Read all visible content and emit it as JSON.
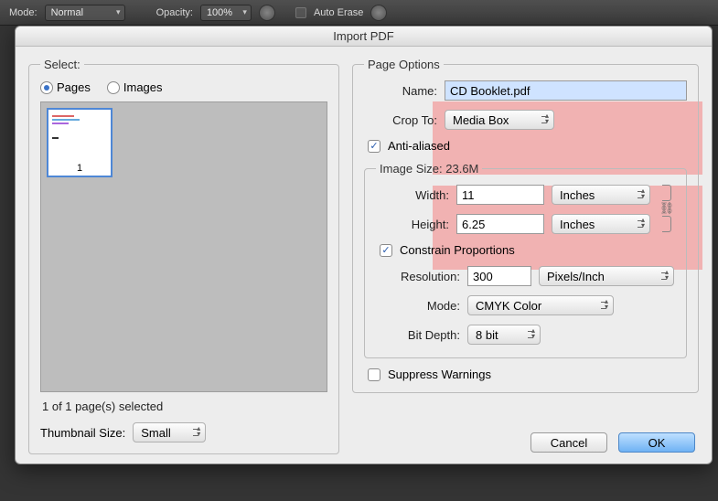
{
  "toolbar": {
    "mode_label": "Mode:",
    "mode_value": "Normal",
    "opacity_label": "Opacity:",
    "opacity_value": "100%",
    "auto_erase": "Auto Erase"
  },
  "dialog": {
    "title": "Import PDF",
    "select": {
      "legend": "Select:",
      "pages": "Pages",
      "images": "Images",
      "thumb_num": "1",
      "selected_text": "1 of 1 page(s) selected",
      "thumbsize_label": "Thumbnail Size:",
      "thumbsize_value": "Small"
    },
    "page_options": {
      "legend": "Page Options",
      "name_label": "Name:",
      "name_value": "CD Booklet.pdf",
      "cropto_label": "Crop To:",
      "cropto_value": "Media Box",
      "antialiased": "Anti-aliased"
    },
    "image_size": {
      "legend": "Image Size: 23.6M",
      "width_label": "Width:",
      "width_value": "11",
      "width_unit": "Inches",
      "height_label": "Height:",
      "height_value": "6.25",
      "height_unit": "Inches",
      "constrain": "Constrain Proportions",
      "res_label": "Resolution:",
      "res_value": "300",
      "res_unit": "Pixels/Inch",
      "mode_label": "Mode:",
      "mode_value": "CMYK Color",
      "bit_label": "Bit Depth:",
      "bit_value": "8 bit"
    },
    "suppress": "Suppress Warnings",
    "cancel": "Cancel",
    "ok": "OK"
  }
}
